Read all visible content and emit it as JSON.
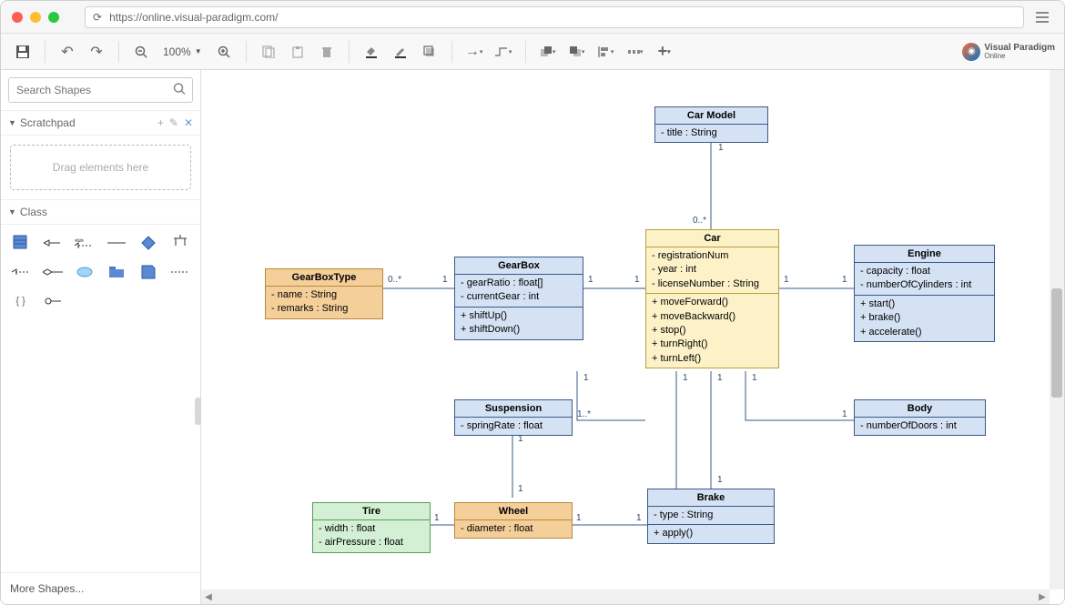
{
  "browser": {
    "url": "https://online.visual-paradigm.com/"
  },
  "toolbar": {
    "zoom": "100%"
  },
  "brand": {
    "name": "Visual Paradigm",
    "sub": "Online"
  },
  "sidebar": {
    "search_placeholder": "Search Shapes",
    "scratchpad_label": "Scratchpad",
    "drop_hint": "Drag elements here",
    "class_label": "Class",
    "more_shapes": "More Shapes..."
  },
  "diagram": {
    "classes": {
      "carModel": {
        "name": "Car Model",
        "attrs": [
          "- title : String"
        ]
      },
      "car": {
        "name": "Car",
        "attrs": [
          "- registrationNum",
          "- year : int",
          "- licenseNumber : String"
        ],
        "ops": [
          "+ moveForward()",
          "+ moveBackward()",
          "+ stop()",
          "+ turnRight()",
          "+ turnLeft()"
        ]
      },
      "engine": {
        "name": "Engine",
        "attrs": [
          "- capacity : float",
          "- numberOfCylinders : int"
        ],
        "ops": [
          "+ start()",
          "+ brake()",
          "+ accelerate()"
        ]
      },
      "gearBox": {
        "name": "GearBox",
        "attrs": [
          "- gearRatio : float[]",
          "- currentGear : int"
        ],
        "ops": [
          "+ shiftUp()",
          "+ shiftDown()"
        ]
      },
      "gearBoxType": {
        "name": "GearBoxType",
        "attrs": [
          "- name : String",
          "- remarks : String"
        ]
      },
      "suspension": {
        "name": "Suspension",
        "attrs": [
          "- springRate : float"
        ]
      },
      "body": {
        "name": "Body",
        "attrs": [
          "- numberOfDoors : int"
        ]
      },
      "wheel": {
        "name": "Wheel",
        "attrs": [
          "- diameter : float"
        ]
      },
      "tire": {
        "name": "Tire",
        "attrs": [
          "- width : float",
          "- airPressure : float"
        ]
      },
      "brake": {
        "name": "Brake",
        "attrs": [
          "- type : String"
        ],
        "ops": [
          "+ apply()"
        ]
      }
    },
    "mults": {
      "carModel_car_top": "1",
      "carModel_car_bottom": "0..*",
      "gearBoxType_gearBox_left": "0..*",
      "gearBoxType_gearBox_right": "1",
      "gearBox_car_left": "1",
      "gearBox_car_right": "1",
      "car_engine_left": "1",
      "car_engine_right": "1",
      "car_suspension_top": "1",
      "car_suspension_bottom": "1..*",
      "car_brake_top": "1",
      "car_brake_bottom": "1",
      "car_body_top": "1",
      "car_body_bottom": "1",
      "suspension_wheel_top": "1",
      "suspension_wheel_bottom": "1",
      "wheel_tire_left": "1",
      "wheel_tire_right": "1",
      "wheel_brake_left": "1",
      "wheel_brake_right": "1"
    }
  }
}
